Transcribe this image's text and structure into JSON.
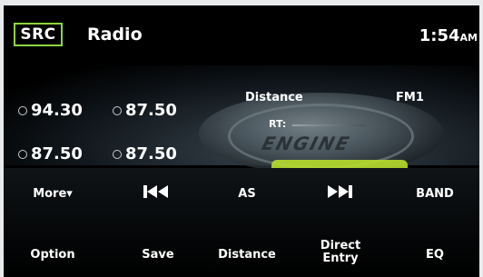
{
  "header": {
    "src_label": "SRC",
    "title": "Radio",
    "time": "1:54",
    "ampm": "AM"
  },
  "presets": [
    "94.30",
    "87.50",
    "87.50",
    "87.50"
  ],
  "station_info": {
    "distance_label": "Distance",
    "band": "FM1",
    "rt_label": "RT:",
    "graphic_text": "ENGINE"
  },
  "buttons_row1": {
    "more": "More▾",
    "prev_icon": "skip-back-icon",
    "as": "AS",
    "next_icon": "skip-forward-icon",
    "band": "BAND"
  },
  "buttons_row2": {
    "option": "Option",
    "save": "Save",
    "distance": "Distance",
    "direct_entry_line1": "Direct",
    "direct_entry_line2": "Entry",
    "eq": "EQ"
  },
  "colors": {
    "accent": "#8dd63d",
    "background": "#000000",
    "bezel": "#e9eaec"
  }
}
